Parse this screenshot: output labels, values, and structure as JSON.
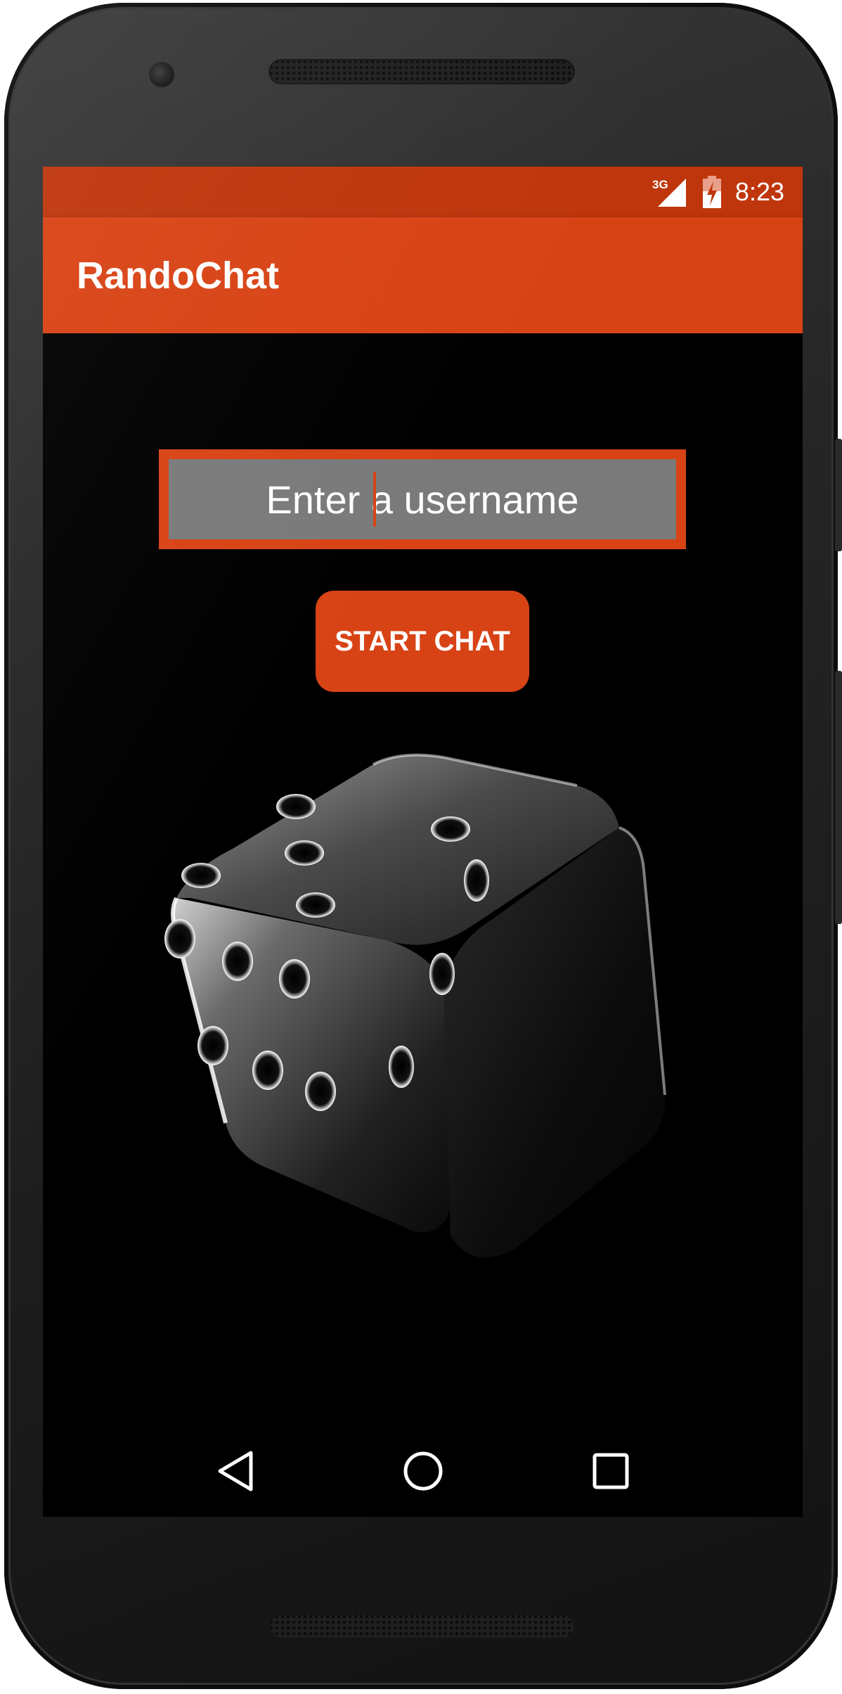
{
  "status_bar": {
    "network": "3G",
    "time": "8:23"
  },
  "app_bar": {
    "title": "RandoChat"
  },
  "main": {
    "username_placeholder": "Enter a username",
    "username_value": "",
    "start_button_label": "START CHAT"
  },
  "nav_bar": {
    "items": [
      "back-icon",
      "home-icon",
      "recents-icon"
    ]
  },
  "colors": {
    "primary": "#d84315",
    "primary_dark": "#bf360c",
    "input_background": "#7a7a7a",
    "screen_background": "#000000"
  }
}
